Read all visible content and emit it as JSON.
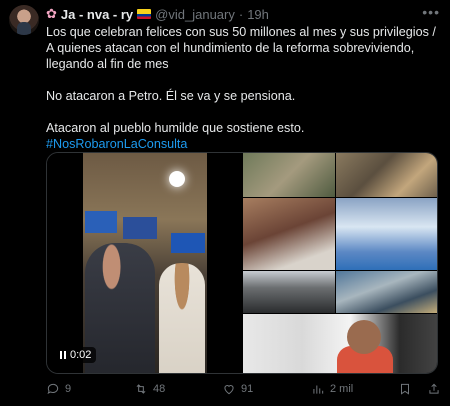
{
  "tweet": {
    "author": {
      "display_name": "Ja - nva - ry",
      "handle": "@vid_january",
      "flower": "✿",
      "time": "19h",
      "separator": "·"
    },
    "paragraphs": [
      "Los que celebran felices con sus 50 millones al mes y sus privilegios / A quienes atacan con el hundimiento de la reforma sobreviviendo, llegando al fin de mes",
      "No atacaron a Petro. Él se va y se pensiona.",
      "Atacaron al pueblo humilde que sostiene esto."
    ],
    "hashtag": "#NosRobaronLaConsulta",
    "video": {
      "timestamp": "0:02"
    },
    "stats": {
      "replies": "9",
      "retweets": "48",
      "likes": "91",
      "views": "2 mil"
    },
    "icons": [
      "more-icon",
      "pause-icon",
      "reply-icon",
      "retweet-icon",
      "like-icon",
      "views-icon",
      "bookmark-icon",
      "share-icon"
    ],
    "colors": {
      "accent": "#1d9bf0",
      "muted": "#71767b",
      "text": "#e7e9ea",
      "background": "#000000"
    }
  }
}
